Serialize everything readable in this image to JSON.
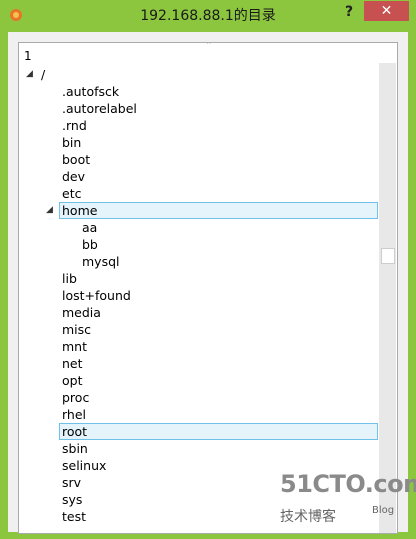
{
  "window": {
    "title": "192.168.88.1的目录",
    "help_label": "?",
    "close_label": "✕"
  },
  "tree": {
    "header_value": "1",
    "nodes": [
      {
        "label": "/",
        "expanded": true
      },
      {
        "label": ".autofsck"
      },
      {
        "label": ".autorelabel"
      },
      {
        "label": ".rnd"
      },
      {
        "label": "bin"
      },
      {
        "label": "boot"
      },
      {
        "label": "dev"
      },
      {
        "label": "etc"
      },
      {
        "label": "home",
        "expanded": true,
        "selected": true
      },
      {
        "label": "aa"
      },
      {
        "label": "bb"
      },
      {
        "label": "mysql"
      },
      {
        "label": "lib"
      },
      {
        "label": "lost+found"
      },
      {
        "label": "media"
      },
      {
        "label": "misc"
      },
      {
        "label": "mnt"
      },
      {
        "label": "net"
      },
      {
        "label": "opt"
      },
      {
        "label": "proc"
      },
      {
        "label": "rhel"
      },
      {
        "label": "root",
        "selected": true
      },
      {
        "label": "sbin"
      },
      {
        "label": "selinux"
      },
      {
        "label": "srv"
      },
      {
        "label": "sys"
      },
      {
        "label": "test"
      }
    ]
  },
  "watermark": {
    "site": "51CTO.com",
    "sub": "技术博客",
    "blog": "Blog"
  },
  "colors": {
    "accent": "#8cc63f",
    "selection_border": "#70c0e7",
    "close_button": "#c75050"
  }
}
